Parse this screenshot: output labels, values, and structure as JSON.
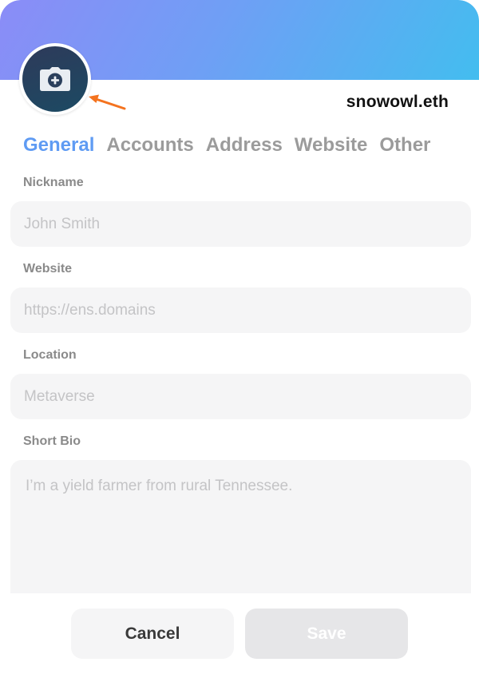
{
  "profile": {
    "ens_name": "snowowl.eth"
  },
  "colors": {
    "banner_start": "#8b8cf7",
    "banner_end": "#43bdef",
    "tab_active": "#5f9bf3",
    "arrow": "#f4731f",
    "avatar_bg": "#24405e"
  },
  "icons": {
    "avatar": "camera-plus-icon",
    "pointer": "arrow-icon"
  },
  "tabs": [
    {
      "label": "General",
      "active": true
    },
    {
      "label": "Accounts",
      "active": false
    },
    {
      "label": "Address",
      "active": false
    },
    {
      "label": "Website",
      "active": false
    },
    {
      "label": "Other",
      "active": false
    }
  ],
  "form": {
    "nickname": {
      "label": "Nickname",
      "placeholder": "John Smith",
      "value": ""
    },
    "website": {
      "label": "Website",
      "placeholder": "https://ens.domains",
      "value": ""
    },
    "location": {
      "label": "Location",
      "placeholder": "Metaverse",
      "value": ""
    },
    "bio": {
      "label": "Short Bio",
      "placeholder": "I’m a yield farmer from rural Tennessee.",
      "value": ""
    }
  },
  "actions": {
    "cancel_label": "Cancel",
    "save_label": "Save"
  }
}
